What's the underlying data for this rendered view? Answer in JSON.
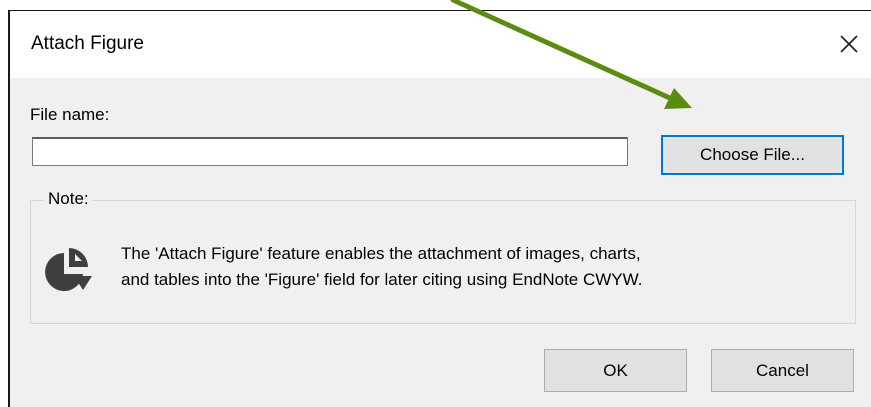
{
  "dialog": {
    "title": "Attach Figure",
    "close_icon": "close-icon"
  },
  "file": {
    "label": "File name:",
    "value": "",
    "placeholder": "",
    "choose_label": "Choose File..."
  },
  "note": {
    "label": "Note:",
    "icon": "pie-chart-icon",
    "line1": "The 'Attach Figure' feature enables the attachment of images, charts,",
    "line2": "and tables into the 'Figure' field for later citing using EndNote CWYW."
  },
  "buttons": {
    "ok_label": "OK",
    "cancel_label": "Cancel"
  },
  "annotation": {
    "arrow_color": "#5b8c11",
    "accent_color": "#0078d7"
  }
}
